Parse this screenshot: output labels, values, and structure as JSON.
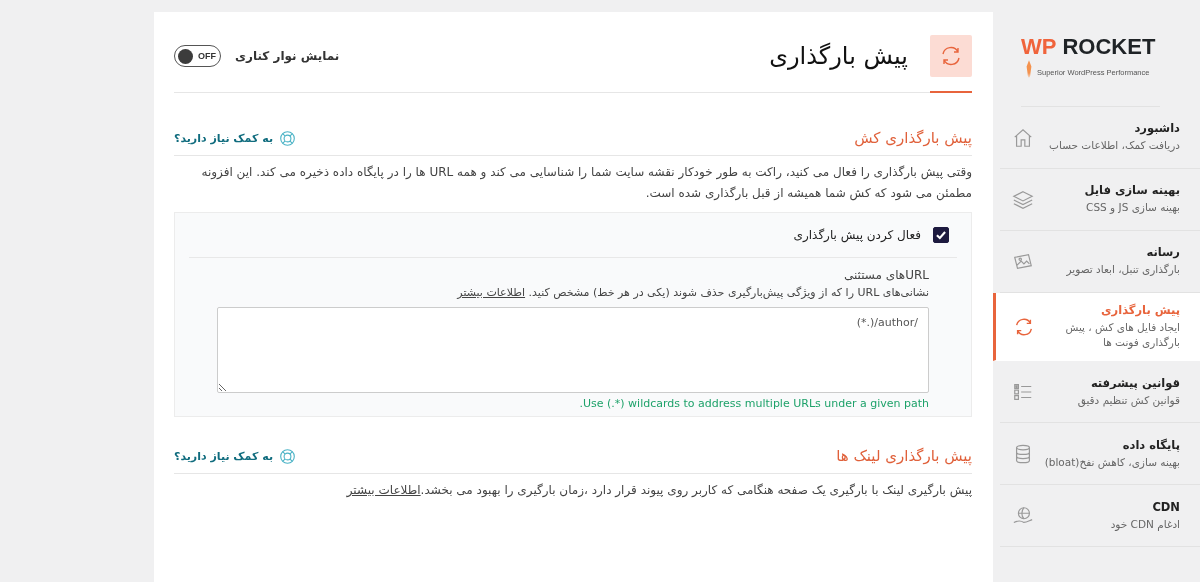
{
  "logo": {
    "mark": "WP",
    "name": "ROCKET",
    "tagline": "Superior WordPress Performance"
  },
  "sidebar": {
    "items": [
      {
        "title": "داشبورد",
        "subtitle": "دریافت کمک، اطلاعات حساب",
        "selected": false
      },
      {
        "title": "بهینه سازی فایل",
        "subtitle": "بهینه سازی JS و CSS",
        "selected": false
      },
      {
        "title": "رسانه",
        "subtitle": "بارگذاری تنبل، ابعاد تصویر",
        "selected": false
      },
      {
        "title": "پیش بارگذاری",
        "subtitle": "ایجاد فایل های کش ، پیش بارگذاری فونت ها",
        "selected": true
      },
      {
        "title": "قوانین پیشرفته",
        "subtitle": "قوانین کش تنظیم دقیق",
        "selected": false
      },
      {
        "title": "پایگاه داده",
        "subtitle": "بهینه سازی، کاهش نفخ(bloat)",
        "selected": false
      },
      {
        "title": "CDN",
        "subtitle": "ادغام CDN خود",
        "selected": false
      }
    ]
  },
  "header": {
    "title": "پیش بارگذاری",
    "sidebar_toggle": {
      "label": "نمایش نوار کناری",
      "state_text": "OFF",
      "on": false
    }
  },
  "sections": [
    {
      "title": "پیش بارگذاری کش",
      "help": "به کمک نیاز دارید؟",
      "description": "وقتی پیش بارگذاری را فعال می کنید، راکت به طور خودکار نقشه سایت شما را شناسایی می کند و همه URL ها را در پایگاه داده ذخیره می کند. این افزونه مطمئن می شود که کش شما همیشه از قبل بارگذاری شده است.",
      "option": {
        "label": "فعال کردن پیش بارگذاری",
        "checked": true,
        "field": {
          "label": "URLهای مستثنی",
          "description": "نشانی‌های URL را که از ویژگی پیش‌بارگیری حذف شوند (یکی در هر خط) مشخص کنید.",
          "link": "اطلاعات بیشتر",
          "value": "/author/(.*)",
          "hint": "Use (.*) wildcards to address multiple URLs under a given path."
        }
      }
    },
    {
      "title": "پیش بارگذاری لینک ها",
      "help": "به کمک نیاز دارید؟",
      "description": "پیش بارگیری لینک با بارگیری یک صفحه هنگامی که کاربر روی پیوند قرار دارد ،زمان بارگیری را بهبود می بخشد.",
      "link": "اطلاعات بیشتر"
    }
  ]
}
